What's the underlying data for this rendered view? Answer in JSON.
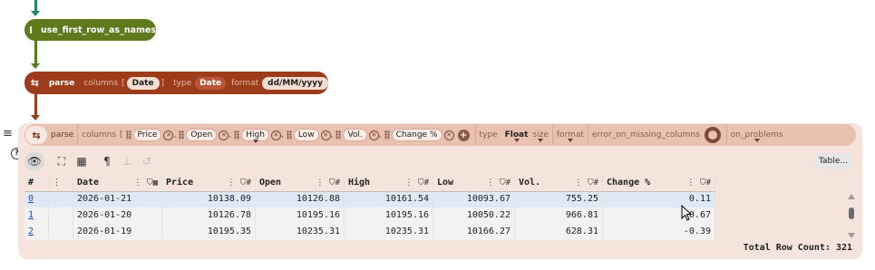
{
  "nodes": {
    "first_row": {
      "label": "use_first_row_as_names"
    },
    "parse_date": {
      "kw_parse": "parse",
      "kw_columns": "columns",
      "bracket_open": "[",
      "column": "Date",
      "bracket_close": "]",
      "kw_type": "type",
      "type_value": "Date",
      "kw_format": "format",
      "format_value": "dd/MM/yyyy"
    },
    "parse_float": {
      "kw_parse": "parse",
      "kw_columns": "columns",
      "bracket_open": "[",
      "columns": [
        "Price",
        "Open",
        "High",
        "Low",
        "Vol.",
        "Change %"
      ],
      "kw_type": "type",
      "type_value": "Float",
      "kw_size": "size",
      "kw_format": "format",
      "kw_error": "error_on_missing_columns",
      "kw_problems": "on_problems"
    }
  },
  "toolbar": {
    "table_button": "Table..."
  },
  "table": {
    "headers": [
      "#",
      "Date",
      "Price",
      "Open",
      "High",
      "Low",
      "Vol.",
      "Change %"
    ],
    "rows": [
      {
        "idx": "0",
        "date": "2026-01-21",
        "price": "10138.09",
        "open": "10126.88",
        "high": "10161.54",
        "low": "10093.67",
        "vol": "755.25",
        "change": "0.11"
      },
      {
        "idx": "1",
        "date": "2026-01-20",
        "price": "10126.78",
        "open": "10195.16",
        "high": "10195.16",
        "low": "10050.22",
        "vol": "966.81",
        "change": "-0.67"
      },
      {
        "idx": "2",
        "date": "2026-01-19",
        "price": "10195.35",
        "open": "10235.31",
        "high": "10235.31",
        "low": "10166.27",
        "vol": "628.31",
        "change": "-0.39"
      }
    ],
    "total_label": "Total Row Count:",
    "total_value": "321"
  },
  "colors": {
    "green_wire": "#1f8a5e",
    "olive_node": "#5e7a1d",
    "brown_node": "#9c3c1b",
    "panel_bg": "#f4e4dc",
    "selected_row": "#dfe9f6"
  }
}
